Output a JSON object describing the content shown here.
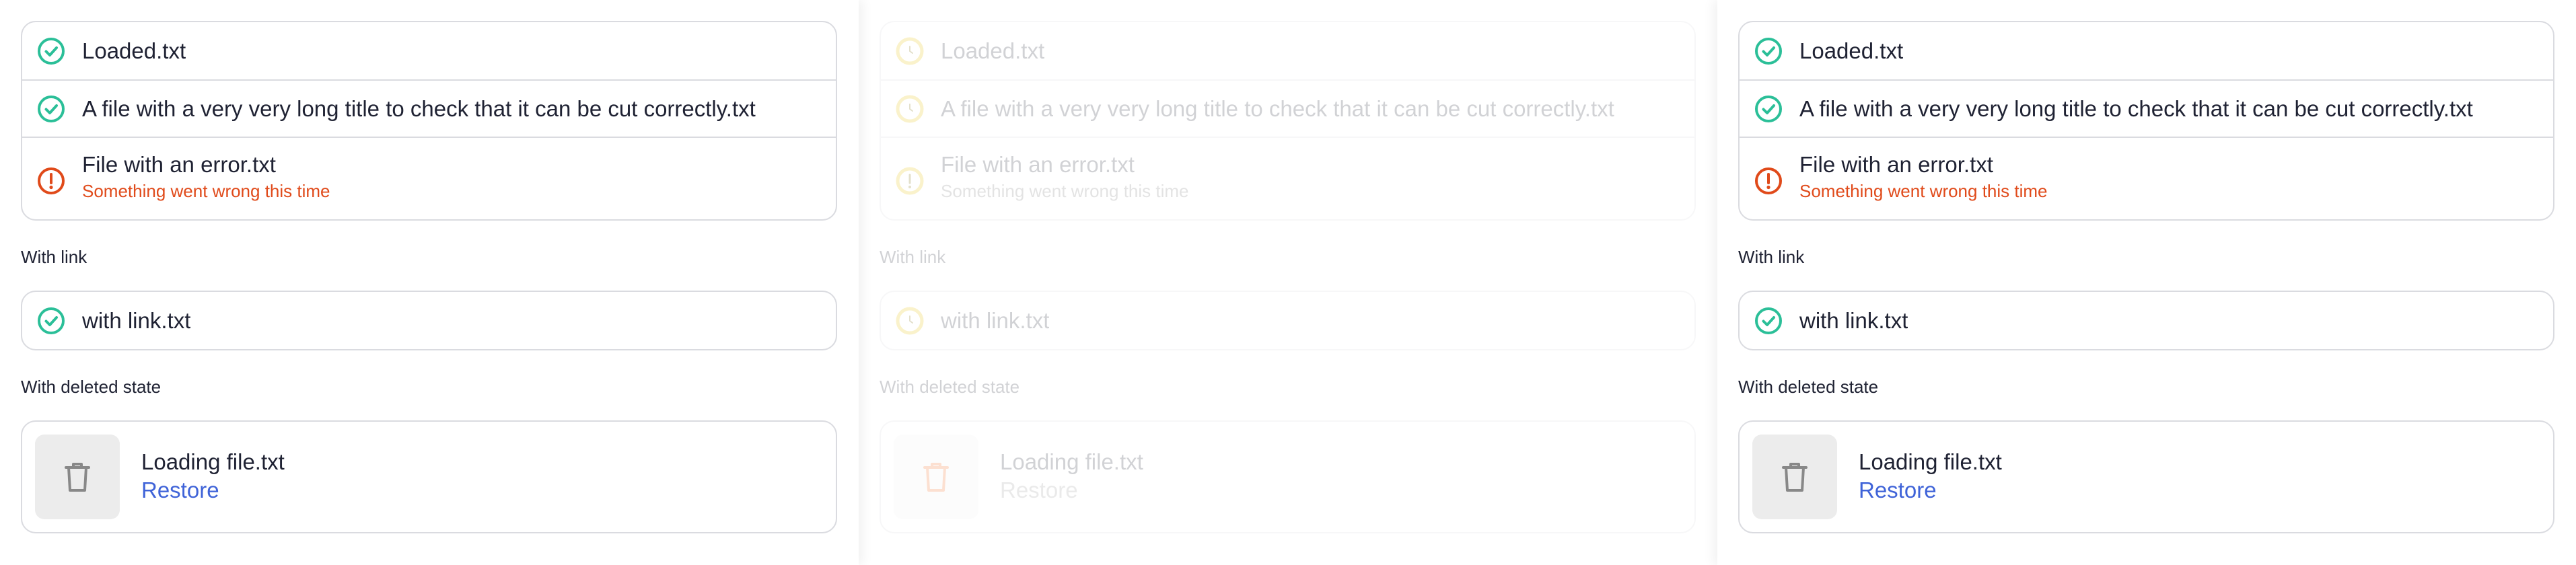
{
  "colors": {
    "success": "#2bbf98",
    "error": "#e04a1a",
    "loading": "#f5d328",
    "link": "#3f63d8",
    "border": "#dadbe0",
    "trash_orange": "#f26b1d"
  },
  "panels": [
    {
      "files": [
        {
          "name": "Loaded.txt",
          "status": "success"
        },
        {
          "name": "A file with a very very long title to check that it can be cut correctly.txt",
          "status": "success"
        },
        {
          "name": "File with an error.txt",
          "status": "error",
          "error": "Something went wrong this time"
        }
      ],
      "link_label": "With link",
      "link_file": "with link.txt",
      "deleted_label": "With deleted state",
      "deleted_file": "Loading file.txt",
      "restore": "Restore"
    },
    {
      "files": [
        {
          "name": "Loaded.txt",
          "status": "loading"
        },
        {
          "name": "A file with a very very long title to check that it can be cut correctly.txt",
          "status": "loading"
        },
        {
          "name": "File with an error.txt",
          "status": "loading",
          "error": "Something went wrong this time"
        }
      ],
      "link_label": "With link",
      "link_file": "with link.txt",
      "deleted_label": "With deleted state",
      "deleted_file": "Loading file.txt",
      "restore": "Restore"
    },
    {
      "files": [
        {
          "name": "Loaded.txt",
          "status": "success"
        },
        {
          "name": "A file with a very very long title to check that it can be cut correctly.txt",
          "status": "success"
        },
        {
          "name": "File with an error.txt",
          "status": "error",
          "error": "Something went wrong this time"
        }
      ],
      "link_label": "With link",
      "link_file": "with link.txt",
      "deleted_label": "With deleted state",
      "deleted_file": "Loading file.txt",
      "restore": "Restore"
    }
  ]
}
